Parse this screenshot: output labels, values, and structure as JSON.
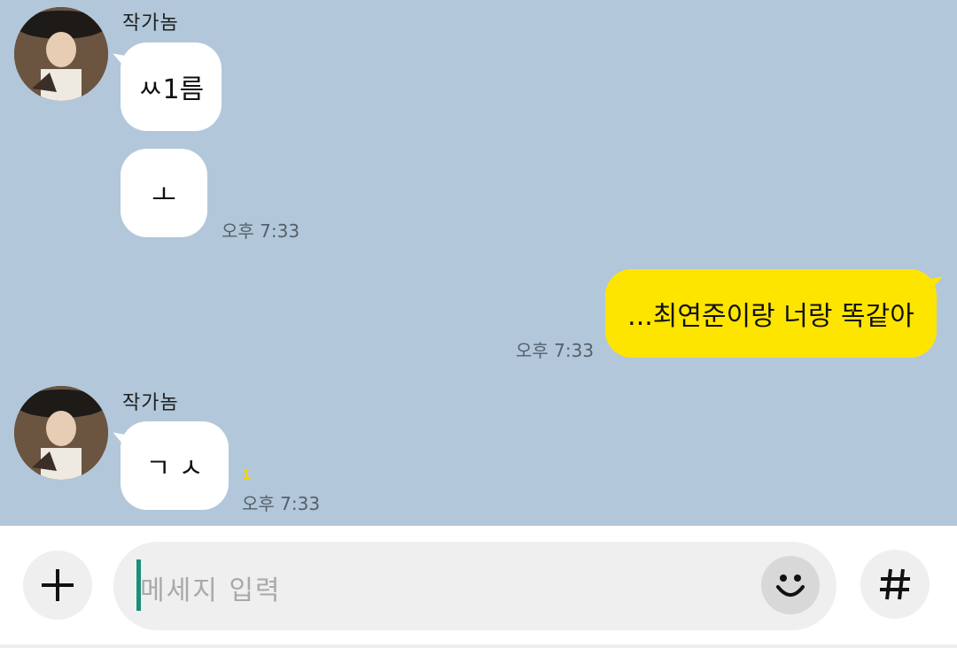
{
  "messages": [
    {
      "sender": "작가놈",
      "bubbles": [
        "ㅆ1름",
        "ㅗ"
      ],
      "time": "오후 7:33"
    },
    {
      "mine": true,
      "text": "...최연준이랑 너랑 똑같아",
      "time": "오후 7:33"
    },
    {
      "sender": "작가놈",
      "bubbles": [
        "ㄱ ㅅ"
      ],
      "unread": "1",
      "time": "오후 7:33"
    }
  ],
  "input": {
    "placeholder": "메세지 입력"
  },
  "icons": {
    "add": "plus-icon",
    "emoji": "smiley-icon",
    "hash": "hash-icon"
  },
  "colors": {
    "background": "#b2c7da",
    "my_bubble": "#fee500",
    "their_bubble": "#ffffff",
    "cursor": "#1a8f7a"
  }
}
